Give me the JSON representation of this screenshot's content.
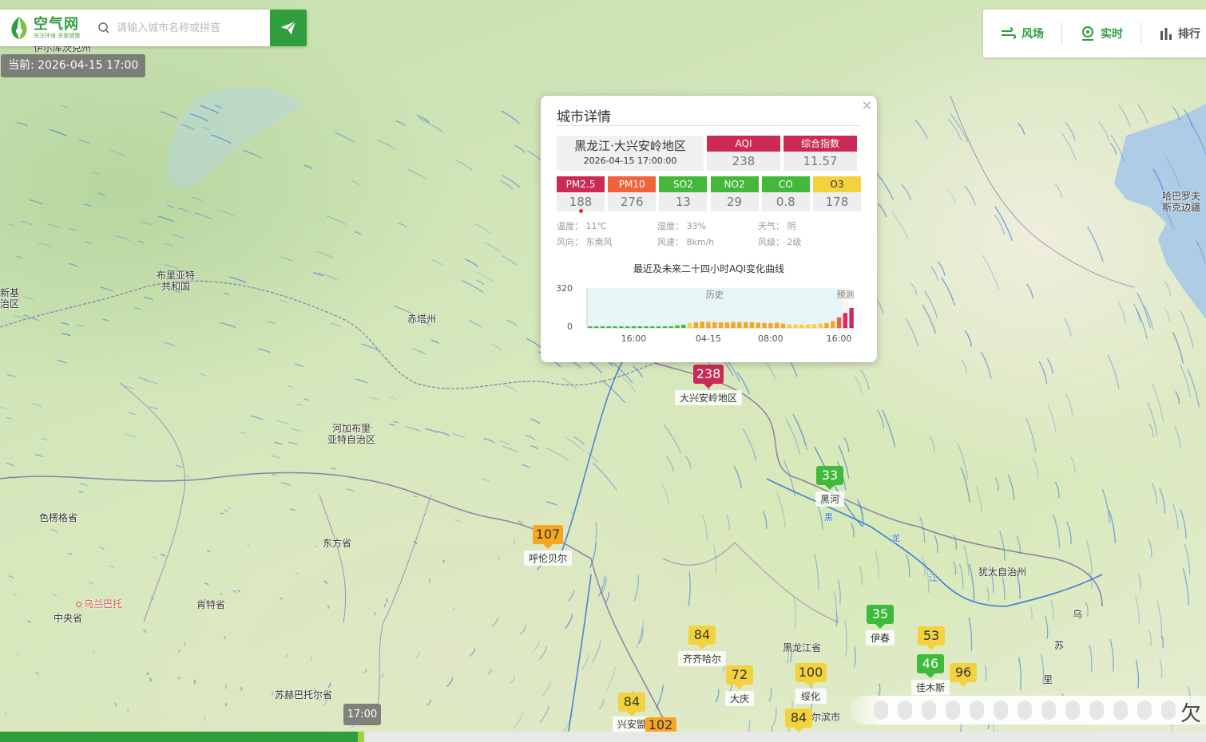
{
  "app": {
    "logo_title": "空气网",
    "logo_slogan": "关注环境 关爱健康",
    "search_placeholder": "请输入城市名称或拼音",
    "current_time": "当前: 2026-04-15 17:00"
  },
  "toolbar": {
    "wind_label": "风场",
    "realtime_label": "实时",
    "rank_label": "排行"
  },
  "map_labels": {
    "irkutsk": "伊尔库茨克州",
    "buryatia": "布里亚特\n共和国",
    "chita": "赤塔州",
    "zabaikalsky": "河加布里\n亚特自治区",
    "selenge": "色楞格省",
    "dornod": "东方省",
    "khentii": "肯特省",
    "ulaanbaatar": "乌兰巴托",
    "tov": "中央省",
    "sukhbaatar": "苏赫巴托尔省",
    "heilongjiang_prov": "黑龙江省",
    "jewish": "犹太自治州",
    "khabarovsk": "哈巴罗夫\n斯克边疆",
    "tuva": "新基\n治区",
    "river_hei": "黑",
    "river_long": "龙",
    "river_jiang": "江",
    "wu": "乌",
    "su": "苏",
    "li": "里",
    "harbin": "尔滨市"
  },
  "cities": [
    {
      "name": "大兴安岭地区",
      "aqi": "238"
    },
    {
      "name": "黑河",
      "aqi": "33"
    },
    {
      "name": "呼伦贝尔",
      "aqi": "107"
    },
    {
      "name": "伊春",
      "aqi": "35"
    },
    {
      "name": "",
      "aqi": "53"
    },
    {
      "name": "佳木斯",
      "aqi": "46"
    },
    {
      "name": "",
      "aqi": "96"
    },
    {
      "name": "齐齐哈尔",
      "aqi": "84"
    },
    {
      "name": "大庆",
      "aqi": "72"
    },
    {
      "name": "绥化",
      "aqi": "100"
    },
    {
      "name": "兴安盟",
      "aqi": "84"
    },
    {
      "name": "",
      "aqi": "102"
    },
    {
      "name": "",
      "aqi": "84"
    }
  ],
  "popup": {
    "title": "城市详情",
    "close": "×",
    "city": "黑龙江·大兴安岭地区",
    "time": "2026-04-15 17:00:00",
    "aqi_label": "AQI",
    "aqi_value": "238",
    "index_label": "综合指数",
    "index_value": "11.57",
    "pollutants": [
      {
        "label": "PM2.5",
        "value": "188",
        "color": "#cc2a56"
      },
      {
        "label": "PM10",
        "value": "276",
        "color": "#f0623b"
      },
      {
        "label": "SO2",
        "value": "13",
        "color": "#43b83b"
      },
      {
        "label": "NO2",
        "value": "29",
        "color": "#43b83b"
      },
      {
        "label": "CO",
        "value": "0.8",
        "color": "#43b83b"
      },
      {
        "label": "O3",
        "value": "178",
        "color": "#f2d33d"
      }
    ],
    "weather": {
      "temp": "温度： 11℃",
      "humidity": "湿度： 33%",
      "sky": "天气： 阴",
      "wind_dir": "风向： 东南风",
      "wind_speed": "风速： 8km/h",
      "wind_level": "风级： 2级"
    },
    "chart_title": "最近及未来二十四小时AQI变化曲线"
  },
  "chart_data": {
    "type": "bar",
    "ylim": [
      0,
      320
    ],
    "y_ticks": [
      "320",
      "0"
    ],
    "x_ticks": [
      {
        "label": "16:00",
        "index": 7
      },
      {
        "label": "04-15",
        "index": 19
      },
      {
        "label": "08:00",
        "index": 29
      },
      {
        "label": "16:00",
        "index": 40
      }
    ],
    "regions": [
      {
        "label": "历史",
        "from": 0,
        "to": 41
      },
      {
        "label": "预测",
        "from": 41,
        "to": 42
      }
    ],
    "values": [
      10,
      10,
      10,
      10,
      10,
      10,
      10,
      10,
      10,
      10,
      10,
      10,
      12,
      12,
      20,
      25,
      40,
      45,
      50,
      48,
      46,
      45,
      46,
      47,
      48,
      47,
      45,
      42,
      40,
      38,
      42,
      35,
      30,
      28,
      27,
      28,
      30,
      35,
      40,
      55,
      85,
      120,
      160
    ],
    "colors": [
      "#43b83b",
      "#43b83b",
      "#43b83b",
      "#43b83b",
      "#43b83b",
      "#43b83b",
      "#43b83b",
      "#43b83b",
      "#43b83b",
      "#43b83b",
      "#43b83b",
      "#43b83b",
      "#43b83b",
      "#43b83b",
      "#43b83b",
      "#43b83b",
      "#f2d33d",
      "#f5a623",
      "#f5a623",
      "#f5a623",
      "#f5a623",
      "#f5a623",
      "#f5a623",
      "#f5a623",
      "#f5a623",
      "#f5a623",
      "#f5a623",
      "#f5a623",
      "#f5a623",
      "#f5a623",
      "#f5a623",
      "#f5a623",
      "#f2d33d",
      "#f2d33d",
      "#f2d33d",
      "#f2d33d",
      "#f2d33d",
      "#f2d33d",
      "#f5a623",
      "#f5a623",
      "#f0623b",
      "#e0245e",
      "#cc2a56"
    ]
  },
  "timeline": {
    "cursor": "17:00"
  },
  "legend": {
    "suffix": "欠"
  }
}
